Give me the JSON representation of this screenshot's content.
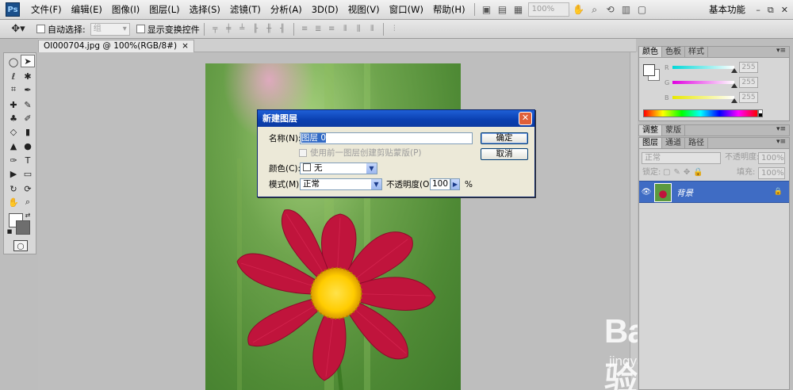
{
  "app": {
    "logo": "Ps"
  },
  "menu": [
    "文件(F)",
    "编辑(E)",
    "图像(I)",
    "图层(L)",
    "选择(S)",
    "滤镜(T)",
    "分析(A)",
    "3D(D)",
    "视图(V)",
    "窗口(W)",
    "帮助(H)"
  ],
  "menubar": {
    "zoom": "100%",
    "workspace": "基本功能",
    "win_min": "–",
    "win_restore": "⧉",
    "win_close": "✕"
  },
  "options": {
    "auto_select": "自动选择:",
    "auto_select_value": "组",
    "show_transform": "显示变换控件"
  },
  "document": {
    "tab": "OI000704.jpg @ 100%(RGB/8#)",
    "close": "×"
  },
  "color_panel": {
    "tabs": [
      "颜色",
      "色板",
      "样式"
    ],
    "sliders": [
      {
        "letter": "R",
        "value": "255",
        "gradient": "#00d8d8"
      },
      {
        "letter": "G",
        "value": "255",
        "gradient": "#e000e0"
      },
      {
        "letter": "B",
        "value": "255",
        "gradient": "#e8e800"
      }
    ]
  },
  "adjust_panel": {
    "tabs": [
      "调整",
      "蒙版"
    ]
  },
  "layers_panel": {
    "tabs": [
      "图层",
      "通道",
      "路径"
    ],
    "blend_mode": "正常",
    "opacity_label": "不透明度:",
    "opacity_value": "100%",
    "lock_label": "锁定:",
    "fill_label": "填充:",
    "fill_value": "100%",
    "layer_name": "背景"
  },
  "dialog": {
    "title": "新建图层",
    "name_label": "名称(N):",
    "name_value": "图层 0",
    "clip_label": "使用前一图层创建剪贴蒙版(P)",
    "color_label": "颜色(C):",
    "color_value": "无",
    "mode_label": "模式(M):",
    "mode_value": "正常",
    "opacity_label": "不透明度(O):",
    "opacity_value": "100",
    "percent": "%",
    "ok": "确定",
    "cancel": "取消"
  },
  "watermark": {
    "brand": "Baidu经验",
    "url": "jingyan.baidu.com"
  },
  "colors": {
    "selection": "#3f6cc4",
    "dialog_title": "#0a3fb0",
    "flower": "#c0143c",
    "center": "#ffd000"
  }
}
